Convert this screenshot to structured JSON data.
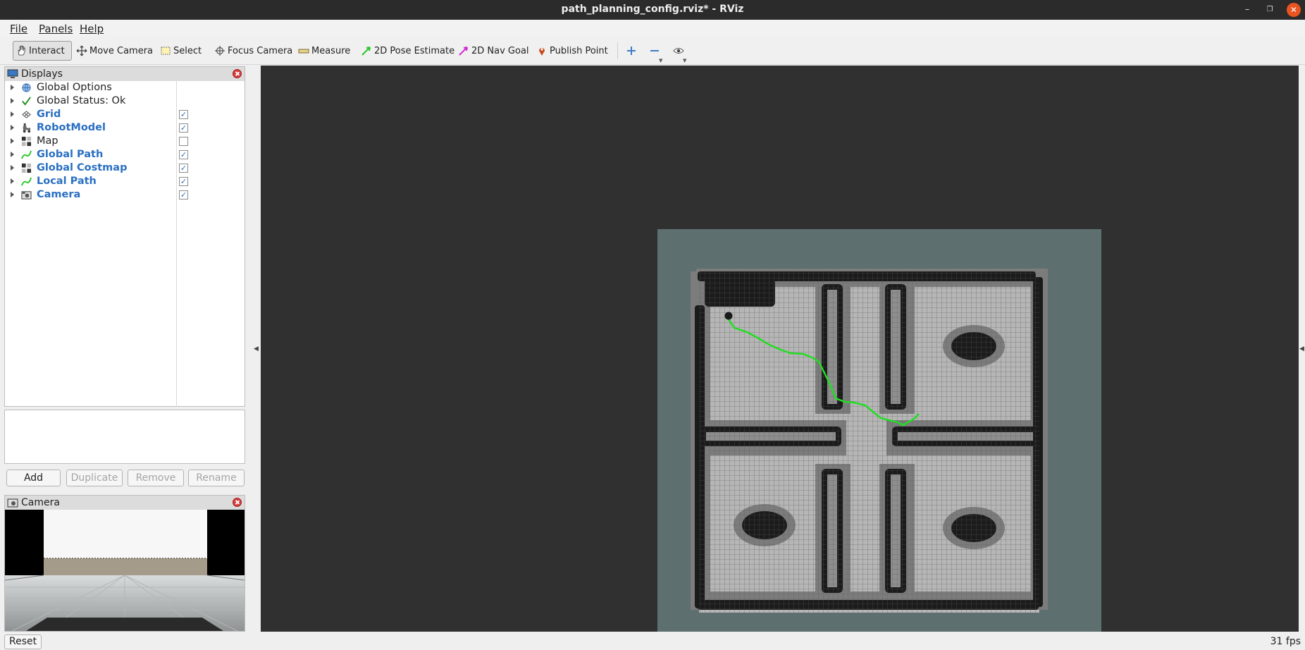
{
  "window": {
    "title": "path_planning_config.rviz* - RViz"
  },
  "menus": [
    "File",
    "Panels",
    "Help"
  ],
  "tools": [
    {
      "label": "Interact",
      "icon": "hand-icon"
    },
    {
      "label": "Move Camera",
      "icon": "move-arrows-icon"
    },
    {
      "label": "Select",
      "icon": "select-rect-icon"
    },
    {
      "label": "Focus Camera",
      "icon": "crosshair-icon"
    },
    {
      "label": "Measure",
      "icon": "ruler-icon"
    },
    {
      "label": "2D Pose Estimate",
      "icon": "green-arrow-icon"
    },
    {
      "label": "2D Nav Goal",
      "icon": "pink-arrow-icon"
    },
    {
      "label": "Publish Point",
      "icon": "map-pin-icon"
    }
  ],
  "displays_panel": {
    "title": "Displays",
    "items": [
      {
        "label": "Global Options",
        "icon": "globe-icon",
        "bold": false,
        "checkbox": null
      },
      {
        "label": "Global Status: Ok",
        "icon": "checkmark-icon",
        "bold": false,
        "checkbox": null
      },
      {
        "label": "Grid",
        "icon": "grid-icon",
        "bold": true,
        "checkbox": true
      },
      {
        "label": "RobotModel",
        "icon": "robot-icon",
        "bold": true,
        "checkbox": true
      },
      {
        "label": "Map",
        "icon": "map-icon",
        "bold": false,
        "checkbox": false
      },
      {
        "label": "Global Path",
        "icon": "path-icon",
        "bold": true,
        "checkbox": true
      },
      {
        "label": "Global Costmap",
        "icon": "map-icon",
        "bold": true,
        "checkbox": true
      },
      {
        "label": "Local Path",
        "icon": "path-icon",
        "bold": true,
        "checkbox": true
      },
      {
        "label": "Camera",
        "icon": "camera-icon",
        "bold": true,
        "checkbox": true
      }
    ],
    "buttons": {
      "add": "Add",
      "duplicate": "Duplicate",
      "remove": "Remove",
      "rename": "Rename"
    }
  },
  "camera_panel": {
    "title": "Camera"
  },
  "statusbar": {
    "reset": "Reset",
    "fps": "31 fps"
  },
  "colors": {
    "path": "#22dd22",
    "costmap_bg": "#5d6f6f",
    "free": "#b8b8b8",
    "obstacle": "#1c1c1c",
    "viewport_bg": "#303030"
  }
}
